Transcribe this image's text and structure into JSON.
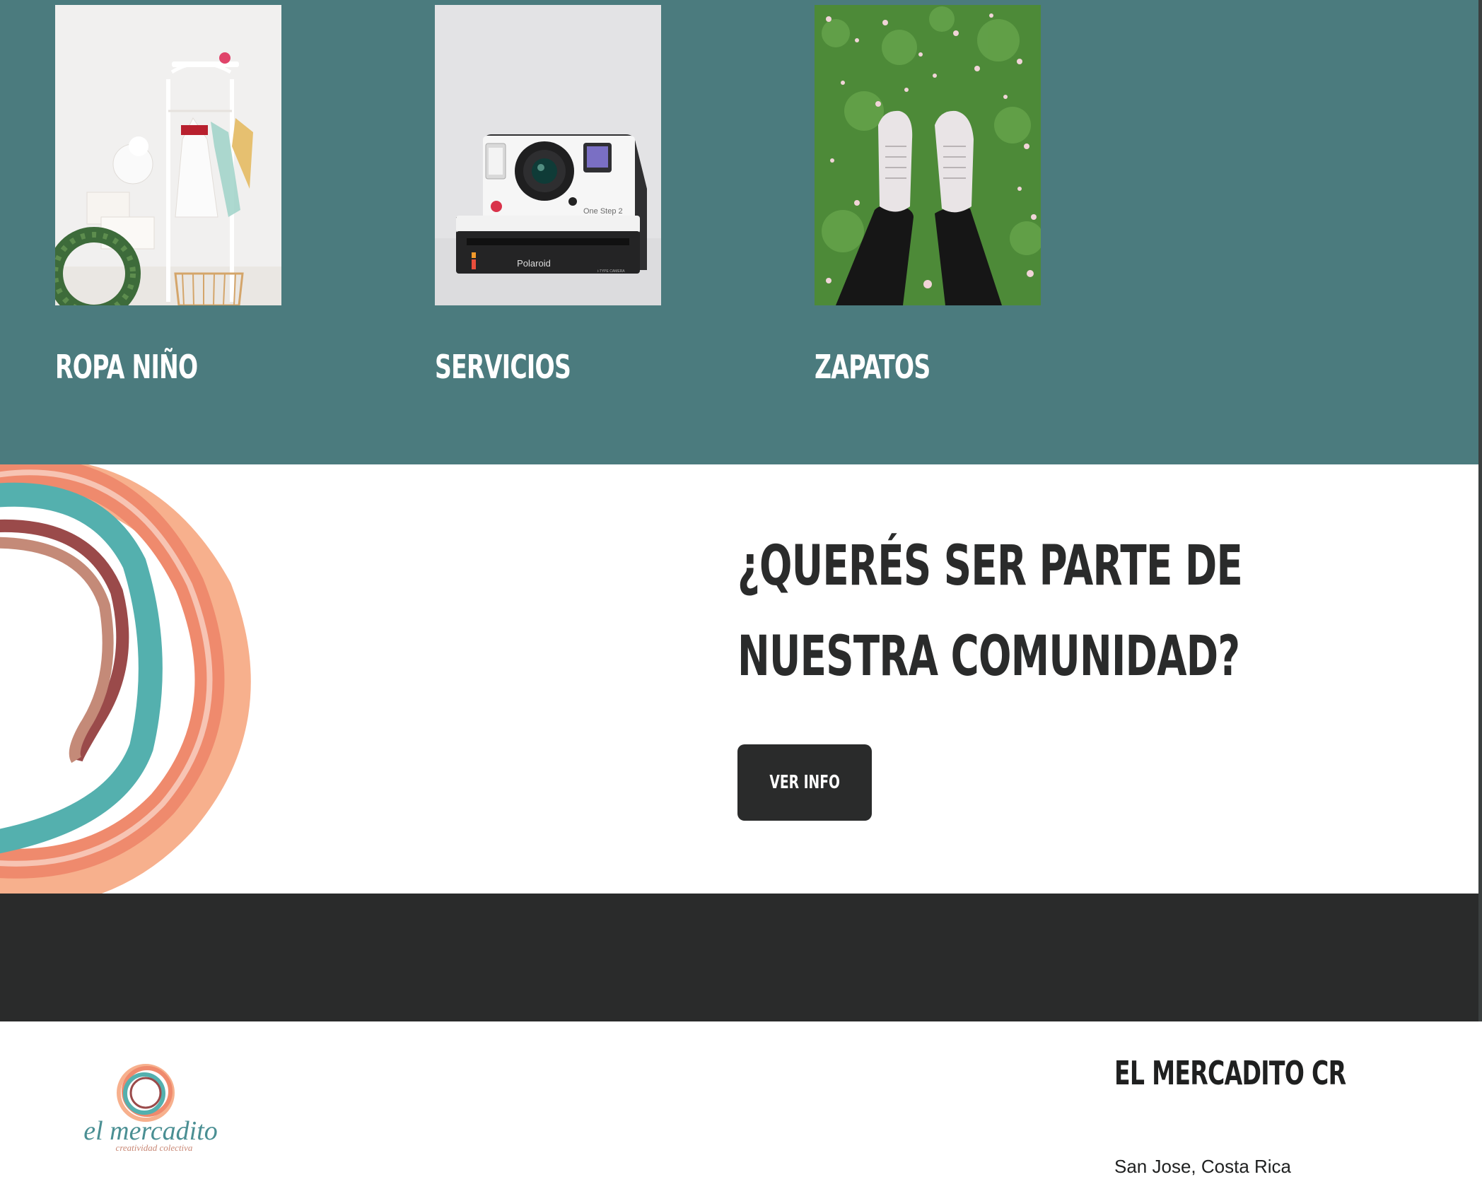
{
  "categories": [
    {
      "label": "ROPA NIÑO",
      "image_icon": "kids-clothes-rack-photo"
    },
    {
      "label": "SERVICIOS",
      "image_icon": "instant-camera-photo"
    },
    {
      "label": "ZAPATOS",
      "image_icon": "sneakers-on-grass-photo"
    }
  ],
  "camera_brand": "Polaroid",
  "camera_model": "One Step 2",
  "camera_type": "i-TYPE CAMERA",
  "cta": {
    "heading": "¿QUERÉS SER PARTE DE NUESTRA COMUNIDAD?",
    "button_label": "VER INFO"
  },
  "footer": {
    "logo_text": "el mercadito",
    "logo_tagline": "creatividad colectiva",
    "title": "EL MERCADITO CR",
    "address": "San Jose, Costa Rica"
  },
  "colors": {
    "teal_section": "#4b7b7e",
    "dark": "#2a2b2b",
    "swirl_teal": "#54b0ae",
    "swirl_coral": "#ef8a6d",
    "swirl_peach": "#f7b08d",
    "swirl_maroon": "#9a4a4a"
  }
}
